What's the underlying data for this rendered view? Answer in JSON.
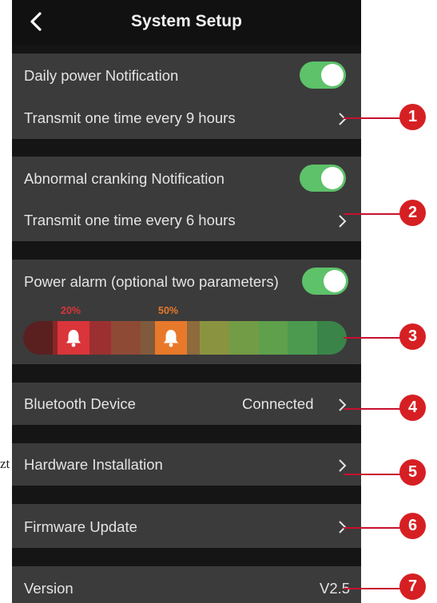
{
  "header": {
    "title": "System Setup",
    "back_icon": "chevron-left-icon"
  },
  "daily_power": {
    "label": "Daily power Notification",
    "enabled": true,
    "interval_text": "Transmit one time every 9 hours",
    "callout": "1"
  },
  "abnormal_cranking": {
    "label": "Abnormal cranking Notification",
    "enabled": true,
    "interval_text": "Transmit one time every 6 hours",
    "callout": "2"
  },
  "power_alarm": {
    "label": "Power alarm (optional two parameters)",
    "enabled": true,
    "markers": [
      {
        "value": "20%",
        "level": 0.2,
        "color": "#d9353a"
      },
      {
        "value": "50%",
        "level": 0.5,
        "color": "#e8792a"
      }
    ],
    "gradient_colors": [
      "#5a2020",
      "#8a2727",
      "#9c3030",
      "#8f4a36",
      "#7f5a3c",
      "#8e6a3c",
      "#8a9440",
      "#729c45",
      "#5fa04c",
      "#4b9a4f",
      "#3a8449"
    ],
    "callout": "3"
  },
  "bluetooth": {
    "label": "Bluetooth Device",
    "status": "Connected",
    "callout": "4"
  },
  "hardware": {
    "label": "Hardware Installation",
    "callout": "5"
  },
  "firmware": {
    "label": "Firmware Update",
    "callout": "6"
  },
  "version": {
    "label": "Version",
    "value": "V2.5",
    "callout": "7"
  },
  "stray_text": "zt",
  "colors": {
    "toggle_on": "#5dc26a",
    "callout_red": "#d61f23",
    "card_bg": "#3b3b3b",
    "background": "#151515"
  }
}
